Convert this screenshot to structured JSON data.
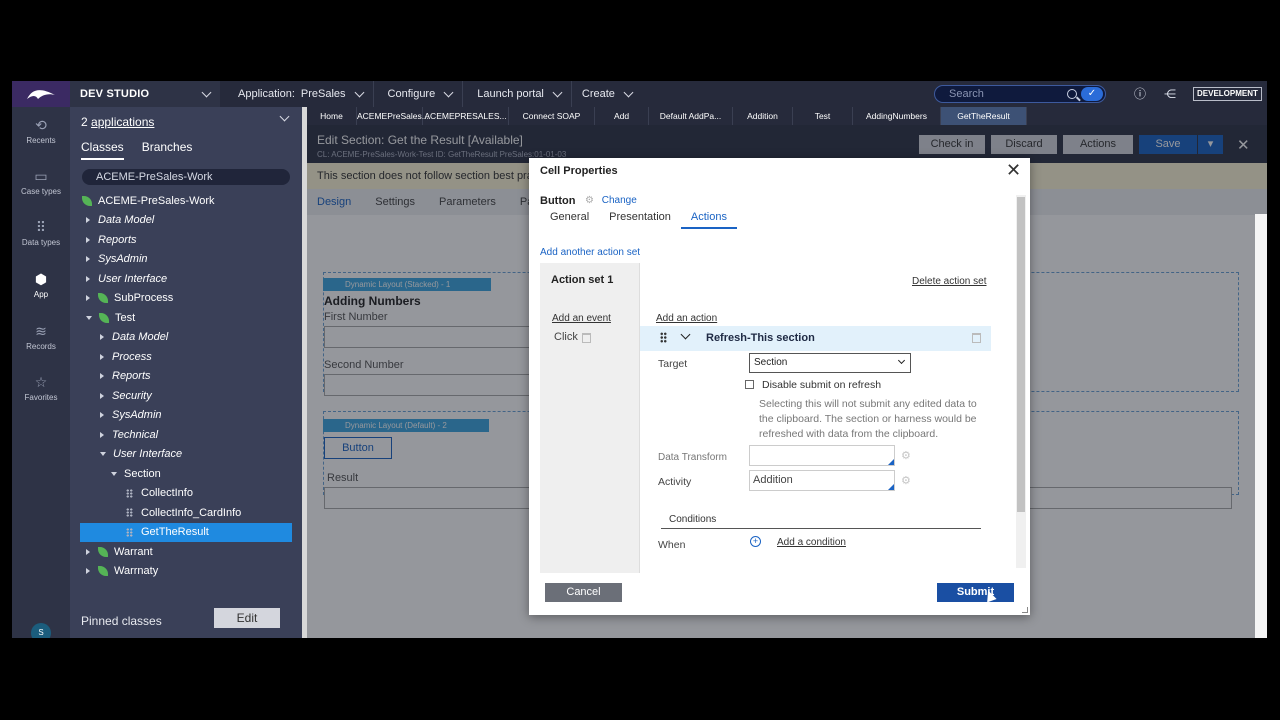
{
  "topbar": {
    "studio": "DEV STUDIO",
    "application_label": "Application:",
    "application_value": "PreSales",
    "configure": "Configure",
    "launch_portal": "Launch portal",
    "create": "Create",
    "search_placeholder": "Search",
    "environment_badge": "DEVELOPMENT"
  },
  "rail": {
    "items": [
      {
        "label": "Recents",
        "icon": "clock-icon"
      },
      {
        "label": "Case types",
        "icon": "case-types-icon"
      },
      {
        "label": "Data types",
        "icon": "data-types-icon"
      },
      {
        "label": "App",
        "icon": "app-cube-icon"
      },
      {
        "label": "Records",
        "icon": "records-icon"
      },
      {
        "label": "Favorites",
        "icon": "star-icon"
      }
    ],
    "avatar": "S"
  },
  "explorer": {
    "apps_count": "2",
    "apps_link": "applications",
    "tabs": [
      "Classes",
      "Branches"
    ],
    "class_filter": "ACEME-PreSales-Work",
    "tree": [
      {
        "label": "ACEME-PreSales-Work",
        "level": 0,
        "icon": "leaf"
      },
      {
        "label": "Data Model",
        "level": 1,
        "icon": "tri-r",
        "italic": true
      },
      {
        "label": "Reports",
        "level": 1,
        "icon": "tri-r",
        "italic": true
      },
      {
        "label": "SysAdmin",
        "level": 1,
        "icon": "tri-r",
        "italic": true
      },
      {
        "label": "User Interface",
        "level": 1,
        "icon": "tri-r",
        "italic": true
      },
      {
        "label": "SubProcess",
        "level": 1,
        "icon": "tri-r-leaf"
      },
      {
        "label": "Test",
        "level": 1,
        "icon": "tri-d-leaf"
      },
      {
        "label": "Data Model",
        "level": 2,
        "icon": "tri-r",
        "italic": true
      },
      {
        "label": "Process",
        "level": 2,
        "icon": "tri-r",
        "italic": true
      },
      {
        "label": "Reports",
        "level": 2,
        "icon": "tri-r",
        "italic": true
      },
      {
        "label": "Security",
        "level": 2,
        "icon": "tri-r",
        "italic": true
      },
      {
        "label": "SysAdmin",
        "level": 2,
        "icon": "tri-r",
        "italic": true
      },
      {
        "label": "Technical",
        "level": 2,
        "icon": "tri-r",
        "italic": true
      },
      {
        "label": "User Interface",
        "level": 2,
        "icon": "tri-d",
        "italic": true
      },
      {
        "label": "Section",
        "level": 3,
        "icon": "tri-d"
      },
      {
        "label": "CollectInfo",
        "level": 4,
        "icon": "dots"
      },
      {
        "label": "CollectInfo_CardInfo",
        "level": 4,
        "icon": "dots"
      },
      {
        "label": "GetTheResult",
        "level": 4,
        "icon": "dots",
        "selected": true
      },
      {
        "label": "Warrant",
        "level": 1,
        "icon": "tri-r-leaf"
      },
      {
        "label": "Warrnaty",
        "level": 1,
        "icon": "tri-r-leaf"
      }
    ],
    "pinned": "Pinned classes",
    "edit": "Edit"
  },
  "doc_tabs": [
    "Home",
    "ACEMEPreSales...",
    "ACEMEPRESALES...",
    "Connect SOAP",
    "Add",
    "Default AddPa...",
    "Addition",
    "Test",
    "AddingNumbers",
    "GetTheResult"
  ],
  "header": {
    "title": "Edit  Section: Get the Result [Available]",
    "subtitle": "CL:  ACEME-PreSales-Work-Test     ID:  GetTheResult     PreSales:01-01-03",
    "check_in": "Check in",
    "discard": "Discard",
    "actions": "Actions",
    "save": "Save"
  },
  "warning": "This section does not follow section best pra",
  "sub_tabs": [
    "Design",
    "Settings",
    "Parameters",
    "Page"
  ],
  "canvas": {
    "layout1": "Dynamic Layout (Stacked) -   1",
    "heading": "Adding Numbers",
    "first_number": "First Number",
    "second_number": "Second Number",
    "layout2": "Dynamic Layout (Default) -   2",
    "button": "Button",
    "result": "Result"
  },
  "modal": {
    "title": "Cell Properties",
    "control": "Button",
    "change": "Change",
    "tabs": [
      "General",
      "Presentation",
      "Actions"
    ],
    "add_action_set": "Add another action set",
    "action_set_title": "Action set 1",
    "delete_action_set": "Delete action set",
    "add_event": "Add an event",
    "event": "Click",
    "add_action": "Add an action",
    "action_title": "Refresh-This section",
    "target_label": "Target",
    "target_value": "Section",
    "disable_submit": "Disable submit on refresh",
    "help": "Selecting this will not submit any edited data to the clipboard. The section or harness would be refreshed with data from the clipboard.",
    "data_transform_label": "Data Transform",
    "data_transform_value": "",
    "activity_label": "Activity",
    "activity_value": "Addition",
    "conditions": "Conditions",
    "when": "When",
    "add_condition": "Add a condition",
    "cancel": "Cancel",
    "submit": "Submit"
  }
}
